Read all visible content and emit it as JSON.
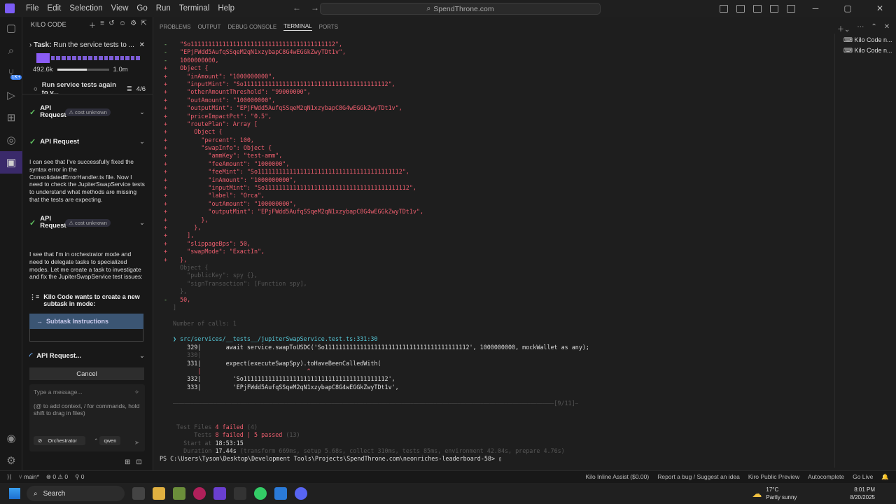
{
  "titlebar": {
    "menu": [
      "File",
      "Edit",
      "Selection",
      "View",
      "Go",
      "Run",
      "Terminal",
      "Help"
    ],
    "command_center": "SpendThrone.com"
  },
  "sidebar": {
    "header": "KILO CODE",
    "task_label": "Task:",
    "task_text": "Run the service tests to ...",
    "tokens_used": "492.6k",
    "tokens_max": "1.0m",
    "token_fraction": 0.58,
    "subtask_text": "Run service tests again to v...",
    "subtask_progress": "4/6",
    "req1_label": "API Request",
    "req1_cost": "cost unknown",
    "req2_label": "API Request",
    "para1": "I can see that I've successfully fixed the syntax error in the ConsolidatedErrorHandler.ts file. Now I need to check the JupiterSwapService tests to understand what methods are missing that the tests are expecting.",
    "req3_label": "API Request",
    "req3_cost": "cost unknown",
    "para2": "I see that I'm in orchestrator mode and need to delegate tasks to specialized modes. Let me create a task to investigate and fix the JupiterSwapService test issues:",
    "kilo_wants": "Kilo Code wants to create a new subtask in mode:",
    "subtask_button": "Subtask Instructions",
    "req4_label": "API Request...",
    "cancel": "Cancel",
    "message_placeholder": "Type a message...",
    "message_hint": "(@ to add context, / for commands, hold shift to drag in files)",
    "mode": "Orchestrator",
    "model": "qwen"
  },
  "panel": {
    "tabs": [
      "PROBLEMS",
      "OUTPUT",
      "DEBUG CONSOLE",
      "TERMINAL",
      "PORTS"
    ],
    "active_tab": "TERMINAL",
    "terminals": [
      "Kilo Code n...",
      "Kilo Code n..."
    ]
  },
  "terminal": {
    "lines": [
      {
        "g": "-",
        "c": "r",
        "t": "  \"So11111111111111111111111111111111111111112\","
      },
      {
        "g": "-",
        "c": "r",
        "t": "  \"EPjFWdd5AufqSSqeM2qN1xzybapC8G4wEGGkZwyTDt1v\","
      },
      {
        "g": "-",
        "c": "r",
        "t": "  1000000000,"
      },
      {
        "g": "+",
        "c": "r",
        "t": "  Object {"
      },
      {
        "g": "+",
        "c": "r",
        "t": "    \"inAmount\": \"1000000000\","
      },
      {
        "g": "+",
        "c": "r",
        "t": "    \"inputMint\": \"So11111111111111111111111111111111111111112\","
      },
      {
        "g": "+",
        "c": "r",
        "t": "    \"otherAmountThreshold\": \"99000000\","
      },
      {
        "g": "+",
        "c": "r",
        "t": "    \"outAmount\": \"100000000\","
      },
      {
        "g": "+",
        "c": "r",
        "t": "    \"outputMint\": \"EPjFWdd5AufqSSqeM2qN1xzybapC8G4wEGGkZwyTDt1v\","
      },
      {
        "g": "+",
        "c": "r",
        "t": "    \"priceImpactPct\": \"0.5\","
      },
      {
        "g": "+",
        "c": "r",
        "t": "    \"routePlan\": Array ["
      },
      {
        "g": "+",
        "c": "r",
        "t": "      Object {"
      },
      {
        "g": "+",
        "c": "r",
        "t": "        \"percent\": 100,"
      },
      {
        "g": "+",
        "c": "r",
        "t": "        \"swapInfo\": Object {"
      },
      {
        "g": "+",
        "c": "r",
        "t": "          \"ammKey\": \"test-amm\","
      },
      {
        "g": "+",
        "c": "r",
        "t": "          \"feeAmount\": \"1000000\","
      },
      {
        "g": "+",
        "c": "r",
        "t": "          \"feeMint\": \"So11111111111111111111111111111111111111112\","
      },
      {
        "g": "+",
        "c": "r",
        "t": "          \"inAmount\": \"1000000000\","
      },
      {
        "g": "+",
        "c": "r",
        "t": "          \"inputMint\": \"So11111111111111111111111111111111111111112\","
      },
      {
        "g": "+",
        "c": "r",
        "t": "          \"label\": \"Orca\","
      },
      {
        "g": "+",
        "c": "r",
        "t": "          \"outAmount\": \"100000000\","
      },
      {
        "g": "+",
        "c": "r",
        "t": "          \"outputMint\": \"EPjFWdd5AufqSSqeM2qN1xzybapC8G4wEGGkZwyTDt1v\","
      },
      {
        "g": "+",
        "c": "r",
        "t": "        },"
      },
      {
        "g": "+",
        "c": "r",
        "t": "      },"
      },
      {
        "g": "+",
        "c": "r",
        "t": "    ],"
      },
      {
        "g": "+",
        "c": "r",
        "t": "    \"slippageBps\": 50,"
      },
      {
        "g": "+",
        "c": "r",
        "t": "    \"swapMode\": \"ExactIn\","
      },
      {
        "g": "+",
        "c": "r",
        "t": "  },"
      },
      {
        "g": "",
        "c": "dim",
        "t": "  Object {"
      },
      {
        "g": "",
        "c": "dim",
        "t": "    \"publicKey\": spy {},"
      },
      {
        "g": "",
        "c": "dim",
        "t": "    \"signTransaction\": [Function spy],"
      },
      {
        "g": "",
        "c": "dim",
        "t": "  },"
      },
      {
        "g": "-",
        "c": "r",
        "t": "  50,"
      },
      {
        "g": "",
        "c": "dim",
        "t": "]"
      },
      {
        "g": "",
        "c": "dim",
        "t": ""
      },
      {
        "g": "",
        "c": "dim",
        "t": "Number of calls: 1"
      },
      {
        "g": "",
        "c": "dim",
        "t": ""
      },
      {
        "g": "",
        "c": "cy",
        "t": "❯ src/services/__tests__/jupiterSwapService.test.ts:331:30"
      },
      {
        "g": "",
        "c": "wh",
        "t": "    329|       await service.swapToUSDC('So11111111111111111111111111111111111111112', 1000000000, mockWallet as any);"
      },
      {
        "g": "",
        "c": "dim",
        "t": "    330|"
      },
      {
        "g": "",
        "c": "wh",
        "t": "    331|       expect(executeSwapSpy).toHaveBeenCalledWith("
      },
      {
        "g": "",
        "c": "r",
        "t": "       |                              ^"
      },
      {
        "g": "",
        "c": "wh",
        "t": "    332|         'So11111111111111111111111111111111111111112',"
      },
      {
        "g": "",
        "c": "wh",
        "t": "    333|         'EPjFWdd5AufqSSqeM2qN1xzybapC8G4wEGGkZwyTDt1v',"
      },
      {
        "g": "",
        "c": "dim",
        "t": ""
      },
      {
        "g": "",
        "c": "dim",
        "t": "⎯⎯⎯⎯⎯⎯⎯⎯⎯⎯⎯⎯⎯⎯⎯⎯⎯⎯⎯⎯⎯⎯⎯⎯⎯⎯⎯⎯⎯⎯⎯⎯⎯⎯⎯⎯⎯⎯⎯⎯⎯⎯⎯⎯⎯⎯⎯⎯⎯⎯⎯⎯⎯⎯⎯⎯⎯⎯⎯⎯⎯⎯⎯⎯⎯⎯⎯⎯⎯⎯⎯⎯⎯⎯⎯⎯⎯⎯⎯⎯⎯⎯⎯⎯⎯⎯⎯⎯⎯⎯⎯⎯⎯⎯⎯⎯⎯⎯⎯⎯⎯⎯⎯⎯⎯⎯⎯⎯⎯⎯⎯⎯⎯⎯⎯⎯⎯⎯⎯⎯⎯⎯⎯⎯⎯⎯⎯⎯⎯⎯[9/11]⎯"
      },
      {
        "g": "",
        "c": "dim",
        "t": ""
      },
      {
        "g": "",
        "c": "dim",
        "t": ""
      }
    ],
    "summary": [
      {
        "k": " Test Files ",
        "v": "4 failed",
        "x": " (4)"
      },
      {
        "k": "      Tests ",
        "v": "8 failed | 5 passed",
        "x": " (13)"
      },
      {
        "k": "   Start at ",
        "v": "18:53:15",
        "x": ""
      },
      {
        "k": "   Duration ",
        "v": "17.44s",
        "x": " (transform 669ms, setup 5.68s, collect 310ms, tests 85ms, environment 42.04s, prepare 4.76s)"
      }
    ],
    "prompt": "PS C:\\Users\\Tyson\\Desktop\\Development Tools\\Projects\\SpendThrone.com\\neonriches-leaderboard-58>"
  },
  "status": {
    "branch": "main*",
    "errors": "0",
    "warnings": "0",
    "ports": "0",
    "inline_assist": "Kilo Inline Assist ($0.00)",
    "report": "Report a bug / Suggest an idea",
    "kiro": "Kiro Public Preview",
    "autocomplete": "Autocomplete",
    "golive": "Go Live"
  },
  "taskbar": {
    "search": "Search",
    "weather_temp": "17°C",
    "weather_desc": "Partly sunny",
    "time": "8:01 PM",
    "date": "8/20/2025"
  }
}
